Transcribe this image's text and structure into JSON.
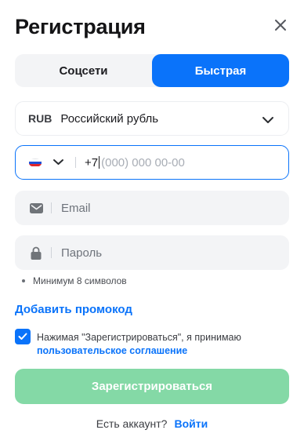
{
  "modal": {
    "title": "Регистрация",
    "close_icon": "close-icon"
  },
  "tabs": [
    {
      "label": "Соцсети",
      "active": false
    },
    {
      "label": "Быстрая",
      "active": true
    }
  ],
  "currency": {
    "code": "RUB",
    "name": "Российский рубль",
    "icon": "chevron-down-icon"
  },
  "phone": {
    "country_flag": "russia-flag-icon",
    "prefix": "+7",
    "placeholder": "(000) 000 00-00"
  },
  "email": {
    "icon": "mail-icon",
    "placeholder": "Email"
  },
  "password": {
    "icon": "lock-icon",
    "placeholder": "Пароль",
    "hint": "Минимум 8 символов"
  },
  "promo": {
    "label": "Добавить промокод"
  },
  "agreement": {
    "checked": true,
    "text": "Нажимая \"Зарегистрироваться\", я принимаю",
    "link": "пользовательское соглашение"
  },
  "submit": {
    "label": "Зарегистрироваться"
  },
  "login": {
    "question": "Есть аккаунт?",
    "link": "Войти"
  },
  "colors": {
    "accent": "#0a73fa",
    "submit_disabled": "#84d9a6",
    "field_bg": "#f3f4f6"
  }
}
